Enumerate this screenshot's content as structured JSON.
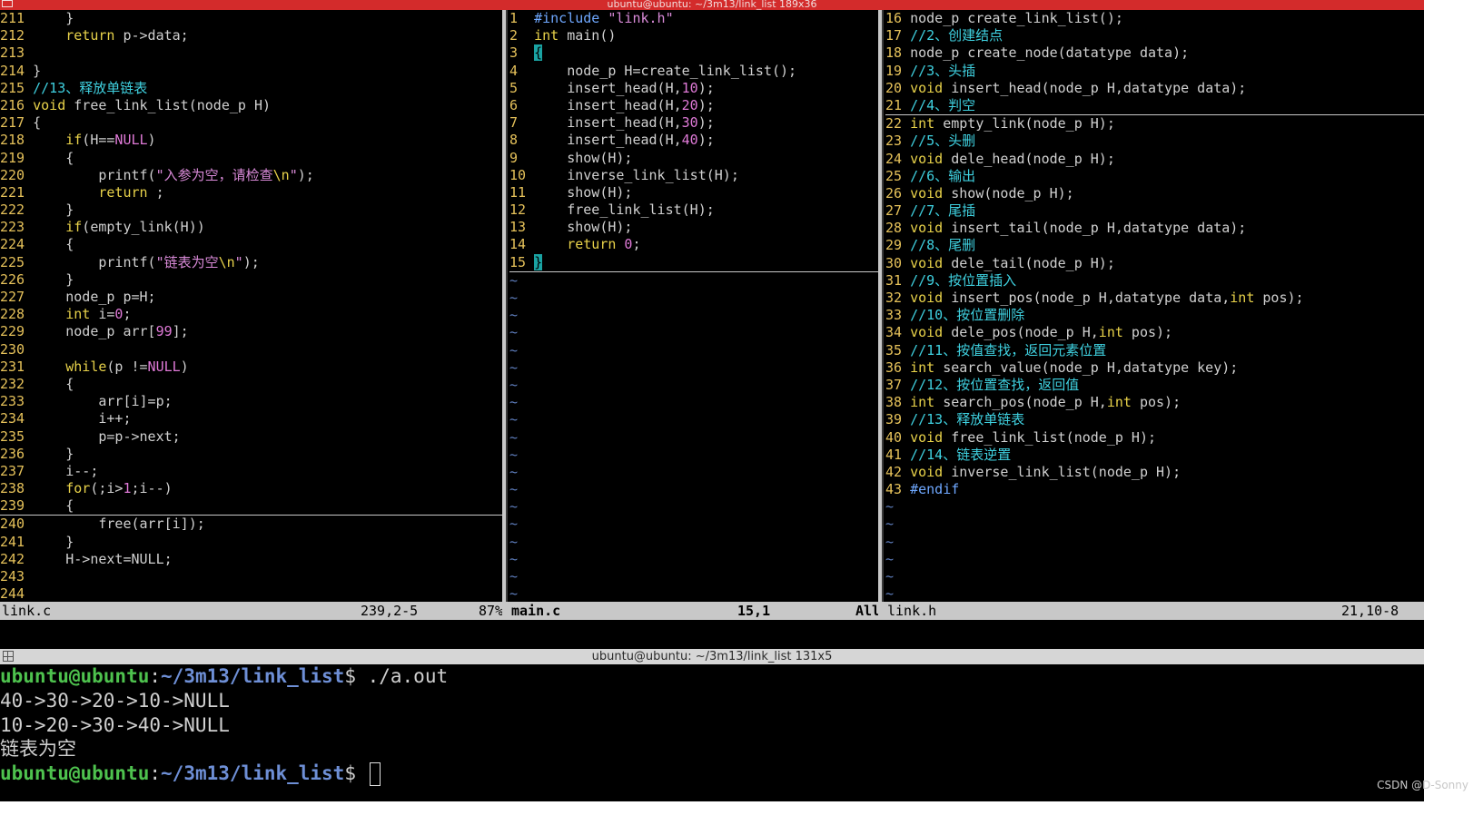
{
  "window": {
    "title": "ubuntu@ubuntu: ~/3m13/link_list 189x36"
  },
  "panes": {
    "left": {
      "filename": "link.c",
      "position": "239,2-5",
      "percent": "87%",
      "lines": [
        {
          "n": "211",
          "t": [
            [
              "    }",
              ""
            ]
          ]
        },
        {
          "n": "212",
          "t": [
            [
              "    ",
              ""
            ],
            [
              "return",
              "kw"
            ],
            [
              " p->data;",
              ""
            ]
          ]
        },
        {
          "n": "213",
          "t": [
            [
              "",
              ""
            ]
          ]
        },
        {
          "n": "214",
          "t": [
            [
              "}",
              ""
            ]
          ]
        },
        {
          "n": "215",
          "t": [
            [
              "//13、释放单链表",
              "com"
            ]
          ]
        },
        {
          "n": "216",
          "t": [
            [
              "void",
              "kw"
            ],
            [
              " free_link_list(node_p H)",
              ""
            ]
          ]
        },
        {
          "n": "217",
          "t": [
            [
              "{",
              ""
            ]
          ]
        },
        {
          "n": "218",
          "t": [
            [
              "    ",
              ""
            ],
            [
              "if",
              "kw"
            ],
            [
              "(H==",
              ""
            ],
            [
              "NULL",
              "num"
            ],
            [
              ")",
              ""
            ]
          ]
        },
        {
          "n": "219",
          "t": [
            [
              "    {",
              ""
            ]
          ]
        },
        {
          "n": "220",
          "t": [
            [
              "        printf(",
              ""
            ],
            [
              "\"入参为空，请检查",
              "str"
            ],
            [
              "\\n",
              "esc"
            ],
            [
              "\"",
              "str"
            ],
            [
              ");",
              ""
            ]
          ]
        },
        {
          "n": "221",
          "t": [
            [
              "        ",
              ""
            ],
            [
              "return",
              "kw"
            ],
            [
              " ;",
              ""
            ]
          ]
        },
        {
          "n": "222",
          "t": [
            [
              "    }",
              ""
            ]
          ]
        },
        {
          "n": "223",
          "t": [
            [
              "    ",
              ""
            ],
            [
              "if",
              "kw"
            ],
            [
              "(empty_link(H))",
              ""
            ]
          ]
        },
        {
          "n": "224",
          "t": [
            [
              "    {",
              ""
            ]
          ]
        },
        {
          "n": "225",
          "t": [
            [
              "        printf(",
              ""
            ],
            [
              "\"链表为空",
              "str"
            ],
            [
              "\\n",
              "esc"
            ],
            [
              "\"",
              "str"
            ],
            [
              ");",
              ""
            ]
          ]
        },
        {
          "n": "226",
          "t": [
            [
              "    }",
              ""
            ]
          ]
        },
        {
          "n": "227",
          "t": [
            [
              "    node_p p=H;",
              ""
            ]
          ]
        },
        {
          "n": "228",
          "t": [
            [
              "    ",
              ""
            ],
            [
              "int",
              "kw"
            ],
            [
              " i=",
              ""
            ],
            [
              "0",
              "num"
            ],
            [
              ";",
              ""
            ]
          ]
        },
        {
          "n": "229",
          "t": [
            [
              "    node_p arr[",
              ""
            ],
            [
              "99",
              "num"
            ],
            [
              "];",
              ""
            ]
          ]
        },
        {
          "n": "230",
          "t": [
            [
              "",
              ""
            ]
          ]
        },
        {
          "n": "231",
          "t": [
            [
              "    ",
              ""
            ],
            [
              "while",
              "kw"
            ],
            [
              "(p !=",
              ""
            ],
            [
              "NULL",
              "num"
            ],
            [
              ")",
              ""
            ]
          ]
        },
        {
          "n": "232",
          "t": [
            [
              "    {",
              ""
            ]
          ]
        },
        {
          "n": "233",
          "t": [
            [
              "        arr[i]=p;",
              ""
            ]
          ]
        },
        {
          "n": "234",
          "t": [
            [
              "        i++;",
              ""
            ]
          ]
        },
        {
          "n": "235",
          "t": [
            [
              "        p=p->next;",
              ""
            ]
          ]
        },
        {
          "n": "236",
          "t": [
            [
              "    }",
              ""
            ]
          ]
        },
        {
          "n": "237",
          "t": [
            [
              "    i--;",
              ""
            ]
          ]
        },
        {
          "n": "238",
          "t": [
            [
              "    ",
              ""
            ],
            [
              "for",
              "kw"
            ],
            [
              "(;i>",
              ""
            ],
            [
              "1",
              "num"
            ],
            [
              ";i--)",
              ""
            ]
          ]
        },
        {
          "n": "239",
          "t": [
            [
              "    {",
              ""
            ]
          ],
          "cursorline": true
        },
        {
          "n": "240",
          "t": [
            [
              "        free(arr[i]);",
              ""
            ]
          ]
        },
        {
          "n": "241",
          "t": [
            [
              "    }",
              ""
            ]
          ]
        },
        {
          "n": "242",
          "t": [
            [
              "    H->next=NULL;",
              ""
            ]
          ]
        },
        {
          "n": "243",
          "t": [
            [
              "",
              ""
            ]
          ]
        },
        {
          "n": "244",
          "t": [
            [
              "",
              ""
            ]
          ]
        }
      ]
    },
    "middle": {
      "filename": "main.c",
      "position": "15,1",
      "percent": "All",
      "lines": [
        {
          "n": "1",
          "t": [
            [
              "#include",
              "pre"
            ],
            [
              " ",
              ""
            ],
            [
              "\"link.h\"",
              "str"
            ]
          ]
        },
        {
          "n": "2",
          "t": [
            [
              "int",
              "kw"
            ],
            [
              " main()",
              ""
            ]
          ]
        },
        {
          "n": "3",
          "t": [
            [
              "{",
              "cur"
            ]
          ]
        },
        {
          "n": "4",
          "t": [
            [
              "    node_p H=create_link_list();",
              ""
            ]
          ]
        },
        {
          "n": "5",
          "t": [
            [
              "    insert_head(H,",
              ""
            ],
            [
              "10",
              "num"
            ],
            [
              ");",
              ""
            ]
          ]
        },
        {
          "n": "6",
          "t": [
            [
              "    insert_head(H,",
              ""
            ],
            [
              "20",
              "num"
            ],
            [
              ");",
              ""
            ]
          ]
        },
        {
          "n": "7",
          "t": [
            [
              "    insert_head(H,",
              ""
            ],
            [
              "30",
              "num"
            ],
            [
              ");",
              ""
            ]
          ]
        },
        {
          "n": "8",
          "t": [
            [
              "    insert_head(H,",
              ""
            ],
            [
              "40",
              "num"
            ],
            [
              ");",
              ""
            ]
          ]
        },
        {
          "n": "9",
          "t": [
            [
              "    show(H);",
              ""
            ]
          ]
        },
        {
          "n": "10",
          "t": [
            [
              "    inverse_link_list(H);",
              ""
            ]
          ]
        },
        {
          "n": "11",
          "t": [
            [
              "    show(H);",
              ""
            ]
          ]
        },
        {
          "n": "12",
          "t": [
            [
              "    free_link_list(H);",
              ""
            ]
          ]
        },
        {
          "n": "13",
          "t": [
            [
              "    show(H);",
              ""
            ]
          ]
        },
        {
          "n": "14",
          "t": [
            [
              "    ",
              ""
            ],
            [
              "return",
              "kw"
            ],
            [
              " ",
              ""
            ],
            [
              "0",
              "num"
            ],
            [
              ";",
              ""
            ]
          ]
        },
        {
          "n": "15",
          "t": [
            [
              "}",
              "cur"
            ]
          ],
          "cursorline": true
        }
      ],
      "tilde_count": 19
    },
    "right": {
      "filename": "link.h",
      "position": "21,10-8",
      "percent": "",
      "lines": [
        {
          "n": "16",
          "t": [
            [
              "node_p create_link_list();",
              ""
            ]
          ]
        },
        {
          "n": "17",
          "t": [
            [
              "//2、创建结点",
              "com"
            ]
          ]
        },
        {
          "n": "18",
          "t": [
            [
              "node_p create_node(datatype data);",
              ""
            ]
          ]
        },
        {
          "n": "19",
          "t": [
            [
              "//3、头插",
              "com"
            ]
          ]
        },
        {
          "n": "20",
          "t": [
            [
              "void",
              "kw"
            ],
            [
              " insert_head(node_p H,datatype data);",
              ""
            ]
          ]
        },
        {
          "n": "21",
          "t": [
            [
              "//4、判空",
              "com"
            ]
          ],
          "cursorline": true
        },
        {
          "n": "22",
          "t": [
            [
              "int",
              "kw"
            ],
            [
              " empty_link(node_p H);",
              ""
            ]
          ]
        },
        {
          "n": "23",
          "t": [
            [
              "//5、头删",
              "com"
            ]
          ]
        },
        {
          "n": "24",
          "t": [
            [
              "void",
              "kw"
            ],
            [
              " dele_head(node_p H);",
              ""
            ]
          ]
        },
        {
          "n": "25",
          "t": [
            [
              "//6、输出",
              "com"
            ]
          ]
        },
        {
          "n": "26",
          "t": [
            [
              "void",
              "kw"
            ],
            [
              " show(node_p H);",
              ""
            ]
          ]
        },
        {
          "n": "27",
          "t": [
            [
              "//7、尾插",
              "com"
            ]
          ]
        },
        {
          "n": "28",
          "t": [
            [
              "void",
              "kw"
            ],
            [
              " insert_tail(node_p H,datatype data);",
              ""
            ]
          ]
        },
        {
          "n": "29",
          "t": [
            [
              "//8、尾删",
              "com"
            ]
          ]
        },
        {
          "n": "30",
          "t": [
            [
              "void",
              "kw"
            ],
            [
              " dele_tail(node_p H);",
              ""
            ]
          ]
        },
        {
          "n": "31",
          "t": [
            [
              "//9、按位置插入",
              "com"
            ]
          ]
        },
        {
          "n": "32",
          "t": [
            [
              "void",
              "kw"
            ],
            [
              " insert_pos(node_p H,datatype data,",
              ""
            ],
            [
              "int",
              "kw"
            ],
            [
              " pos);",
              ""
            ]
          ]
        },
        {
          "n": "33",
          "t": [
            [
              "//10、按位置删除",
              "com"
            ]
          ]
        },
        {
          "n": "34",
          "t": [
            [
              "void",
              "kw"
            ],
            [
              " dele_pos(node_p H,",
              ""
            ],
            [
              "int",
              "kw"
            ],
            [
              " pos);",
              ""
            ]
          ]
        },
        {
          "n": "35",
          "t": [
            [
              "//11、按值查找，返回元素位置",
              "com"
            ]
          ]
        },
        {
          "n": "36",
          "t": [
            [
              "int",
              "kw"
            ],
            [
              " search_value(node_p H,datatype key);",
              ""
            ]
          ]
        },
        {
          "n": "37",
          "t": [
            [
              "//12、按位置查找，返回值",
              "com"
            ]
          ]
        },
        {
          "n": "38",
          "t": [
            [
              "int",
              "kw"
            ],
            [
              " search_pos(node_p H,",
              ""
            ],
            [
              "int",
              "kw"
            ],
            [
              " pos);",
              ""
            ]
          ]
        },
        {
          "n": "39",
          "t": [
            [
              "//13、释放单链表",
              "com"
            ]
          ]
        },
        {
          "n": "40",
          "t": [
            [
              "void",
              "kw"
            ],
            [
              " free_link_list(node_p H);",
              ""
            ]
          ]
        },
        {
          "n": "41",
          "t": [
            [
              "//14、链表逆置",
              "com"
            ]
          ]
        },
        {
          "n": "42",
          "t": [
            [
              "void",
              "kw"
            ],
            [
              " inverse_link_list(node_p H);",
              ""
            ]
          ]
        },
        {
          "n": "43",
          "t": [
            [
              "#endif",
              "pre"
            ]
          ]
        }
      ],
      "tilde_count": 6
    }
  },
  "terminal": {
    "title": "ubuntu@ubuntu: ~/3m13/link_list 131x5",
    "lines": [
      {
        "user": "ubuntu@ubuntu",
        "path": "~/3m13/link_list",
        "cmd": "$ ./a.out"
      },
      {
        "text": "40->30->20->10->NULL"
      },
      {
        "text": "10->20->30->40->NULL"
      },
      {
        "text": "链表为空"
      },
      {
        "user": "ubuntu@ubuntu",
        "path": "~/3m13/link_list",
        "cmd": "$ ",
        "cursor": true
      }
    ]
  },
  "watermark": "CSDN @D-Sonny",
  "colors": {
    "background": "#000000",
    "comment": "#3fd1e0",
    "keyword": "#e8d24a",
    "string": "#d98ad8",
    "line_number": "#e5c15a",
    "prompt_user": "#4ec24e",
    "prompt_path": "#6e8fd6",
    "titlebar_red": "#d32b2b"
  }
}
